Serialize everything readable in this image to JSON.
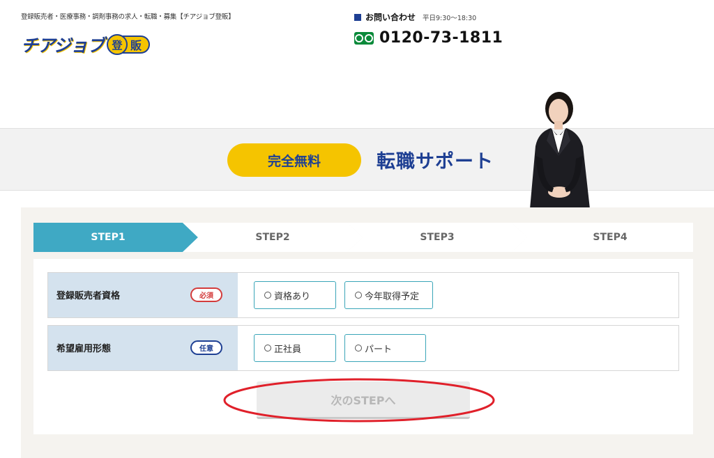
{
  "header": {
    "tagline": "登録販売者・医療事務・調剤事務の求人・転職・募集【チアジョブ登販】",
    "logo_text": "チアジョブ",
    "logo_badge_char": "登",
    "logo_badge_text": "販"
  },
  "contact": {
    "label": "お問い合わせ",
    "hours": "平日9:30〜18:30",
    "phone": "0120-73-1811",
    "icon": "freedial-icon"
  },
  "banner": {
    "free_label": "完全無料",
    "title": "転職サポート"
  },
  "steps": [
    {
      "label": "STEP1",
      "active": true
    },
    {
      "label": "STEP2",
      "active": false
    },
    {
      "label": "STEP3",
      "active": false
    },
    {
      "label": "STEP4",
      "active": false
    }
  ],
  "form": {
    "rows": [
      {
        "label": "登録販売者資格",
        "badge": "必須",
        "options": [
          "資格あり",
          "今年取得予定"
        ]
      },
      {
        "label": "希望雇用形態",
        "badge": "任意",
        "options": [
          "正社員",
          "パート"
        ]
      }
    ],
    "next_button": "次のSTEPへ"
  },
  "colors": {
    "brand_navy": "#1e3f93",
    "brand_yellow": "#f5c400",
    "step_active": "#3fa9c4",
    "required_red": "#d33b3b",
    "annotation_red": "#e0202a"
  }
}
